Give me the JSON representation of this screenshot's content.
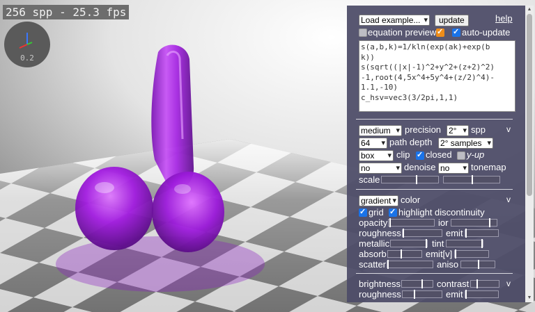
{
  "fps_label": "256 spp - 25.3 fps",
  "gizmo_scale": "0.2",
  "header": {
    "example_select": "Load example...",
    "update_button": "update",
    "help_link": "help",
    "equation_preview_label": "equation preview",
    "auto_update_label": "auto-update"
  },
  "equation_lines": [
    "s(a,b,k)=1/kln(exp(ak)+exp(b",
    "k))",
    "s(sqrt((|x|-1)^2+y^2+(z+2)^2)",
    "-1,root(4,5x^4+5y^4+(z/2)^4)-",
    "1.1,-10)",
    "c_hsv=vec3(3/2pi,1,1)"
  ],
  "render": {
    "precision_select": "medium",
    "precision_label": "precision",
    "spp_select": "2°",
    "spp_label": "spp",
    "path_depth_select": "64",
    "path_depth_label": "path depth",
    "samples_select": "2° samples",
    "clip_select": "box",
    "clip_label": "clip",
    "closed_label": "closed",
    "yup_label": "y-up",
    "denoise_select": "no",
    "denoise_label": "denoise",
    "tonemap_select": "no",
    "tonemap_label": "tonemap",
    "scale_label": "scale",
    "collapse": "v"
  },
  "material": {
    "color_select": "gradient",
    "color_label": "color",
    "grid_label": "grid",
    "highlight_label": "highlight discontinuity",
    "opacity_label": "opacity",
    "ior_label": "ior",
    "roughness_label": "roughness",
    "emit_label": "emit",
    "metallic_label": "metallic",
    "tint_label": "tint",
    "absorb_label": "absorb",
    "emitv_label": "emit[v]",
    "scatter_label": "scatter",
    "aniso_label": "aniso",
    "collapse": "v"
  },
  "lighting": {
    "brightness_label": "brightness",
    "contrast_label": "contrast",
    "roughness_label": "roughness",
    "emit_label": "emit",
    "collapse": "v"
  },
  "colors": {
    "panel": "#4e4c68",
    "object": "#a21ce0",
    "accent_checkbox": "#1a73e8",
    "preview_checkbox": "#ee8d1a"
  }
}
